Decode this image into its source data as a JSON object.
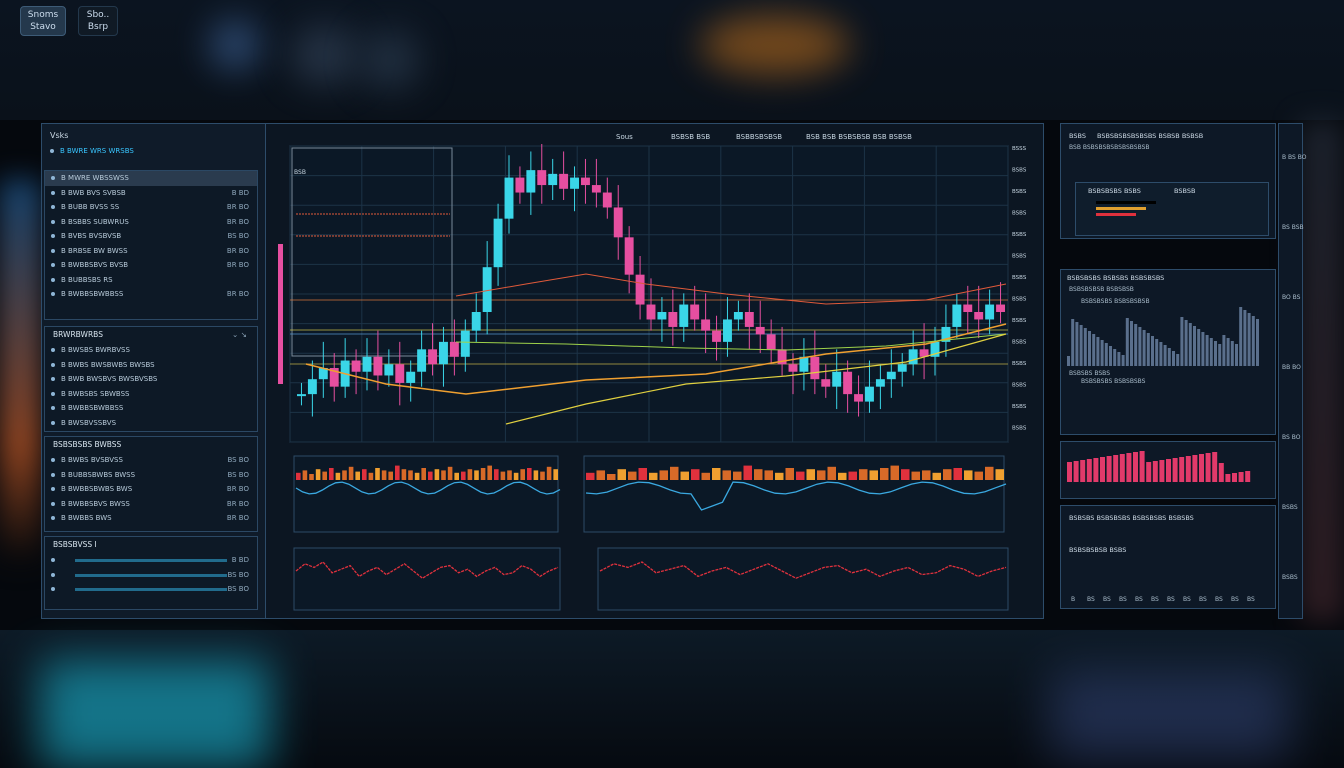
{
  "top_buttons": [
    {
      "line1": "Snoms",
      "line2": "Stavo"
    },
    {
      "line1": "Sbo..",
      "line2": "Bsrp"
    }
  ],
  "left_panel": {
    "title": "Vsks",
    "top_item": "B BWRE WRS WRSBS",
    "group1": [
      {
        "label": "B MWRE WBSSWSS",
        "value": ""
      },
      {
        "label": "B BWB BVS SVBSB",
        "value": "B BD"
      },
      {
        "label": "B BUBB BVSS SS",
        "value": "BR BO"
      },
      {
        "label": "B BSBBS SUBWRUS",
        "value": "BR BO"
      },
      {
        "label": "B BVBS BVSBVSB",
        "value": "BS BO"
      },
      {
        "label": "B BRBSE BW BWSS",
        "value": "BR BO"
      },
      {
        "label": "B BWBBSBVS BVSB",
        "value": "BR BO"
      },
      {
        "label": "B BUBBSBS RS",
        "value": ""
      },
      {
        "label": "B BWBBSBWBBSS",
        "value": "BR BO"
      }
    ],
    "group2_head": "BRWRBWRBS",
    "group2": [
      "B BWSBS BWRBVSS",
      "B BWBS BWSBWBS BWSBS",
      "B BWB BWSBVS BWSBVSBS",
      "B BWBSBS SBWBSS",
      "B BWBBSBWBBSS",
      "B BWSBVSSBVS"
    ],
    "group3_head": "BSBSBSBS BWBSS",
    "group3": [
      {
        "label": "B BWBS BVSBVSS",
        "value": "BS BO"
      },
      {
        "label": "B BUBBSBWBS BWSS",
        "value": "BS BO"
      },
      {
        "label": "B BWBBSBWBS BWS",
        "value": "BR BO"
      },
      {
        "label": "B BWBBSBVS BWSS",
        "value": "BR BO"
      },
      {
        "label": "B BWBBS BWS",
        "value": "BR BO"
      }
    ],
    "group4_head": "BSBSBVSS I",
    "group4": [
      {
        "label": "",
        "value": "B BD"
      },
      {
        "label": "",
        "value": "BS BO"
      },
      {
        "label": "",
        "value": "BS BO"
      }
    ]
  },
  "main_chart": {
    "title_parts": [
      "Sous",
      "BSBSB BSB",
      "BSBBSBSBSB",
      "BSB BSB BSBSBSB BSB BSBSB"
    ],
    "ylabels": [
      "BSSS",
      "BSBS",
      "BSBS",
      "BSBS",
      "BSBS",
      "BSBS",
      "BSBS",
      "BSBS",
      "BSBS",
      "BSBS",
      "BSBS",
      "BSBS",
      "BSBS",
      "BSBS"
    ],
    "inset_tag": "BSB",
    "colors": {
      "up": "#3ad6e8",
      "down": "#e64fa0",
      "ma_orange": "#f0a030",
      "ma_red": "#e05a3a",
      "ma_yellow": "#e0d040",
      "ma_green": "#9fd34a"
    }
  },
  "chart_data": [
    {
      "type": "candlestick",
      "title": "",
      "close": [
        38,
        42,
        45,
        40,
        47,
        44,
        48,
        43,
        46,
        41,
        44,
        50,
        46,
        52,
        48,
        55,
        60,
        72,
        85,
        96,
        92,
        98,
        94,
        97,
        93,
        96,
        94,
        92,
        88,
        80,
        70,
        62,
        58,
        60,
        56,
        62,
        58,
        55,
        52,
        58,
        60,
        56,
        54,
        50,
        46,
        44,
        48,
        42,
        40,
        44,
        38,
        36,
        40,
        42,
        44,
        46,
        50,
        48,
        52,
        56,
        62,
        60,
        58,
        62,
        60
      ]
    },
    {
      "type": "bar",
      "title": "",
      "values": [
        6,
        8,
        5,
        9,
        7,
        10,
        6,
        8,
        11,
        7,
        9,
        6,
        10,
        8,
        7,
        12,
        9,
        8,
        6,
        10,
        7,
        9,
        8,
        11,
        6,
        7,
        9,
        8,
        10,
        12,
        9,
        7,
        8,
        6,
        9,
        10,
        8,
        7,
        11,
        9
      ]
    },
    {
      "type": "line",
      "title": "",
      "values": [
        50,
        42,
        46,
        40,
        52,
        48,
        44,
        56,
        50,
        46,
        54,
        48,
        42,
        50,
        58,
        52,
        46,
        44,
        52,
        48,
        56,
        50,
        46,
        54,
        52,
        44,
        48,
        56,
        50,
        46
      ]
    }
  ],
  "right_panel": {
    "head_title": "BSBS",
    "head_sub": "BSBSBSBSBSBSBS BSBSB BSBSB",
    "head_sub2": "BSB BSBSBSBSBSBSBSBSB",
    "side_vals": [
      "B BS BO",
      "BS BSB",
      "BO BS",
      "BB BO",
      "BS BO",
      "BSBS",
      "BSBS"
    ],
    "box1_title": "BSBSBSBS BSBS",
    "box1_tag": "BSBSB",
    "mid_title": "BSBSBSBS BSBSBS BSBSBSBS",
    "mid_sub": "BSBSBSBSB BSBSBSB",
    "mid_sub2": "BSBSBSBS BSBSBSBSB",
    "low_title": "BSBSBS BSBS",
    "low_sub": "BSBSBSBS BSBSBSBS",
    "bottom_title": "BSBSBS BSBSBSBS BSBSBSBS BSBSBS",
    "bottom_sub": "BSBSBSBSB BSBS",
    "bottom_ticks": [
      "B",
      "BS",
      "BS",
      "BS",
      "BS",
      "BS",
      "BS",
      "BS",
      "BS",
      "BS",
      "BS",
      "BS"
    ],
    "colors": {
      "bars_blue": "#5a6f8c",
      "bars_pink": "#e23a6a",
      "green": "#45c04a",
      "red": "#e0313d"
    }
  }
}
